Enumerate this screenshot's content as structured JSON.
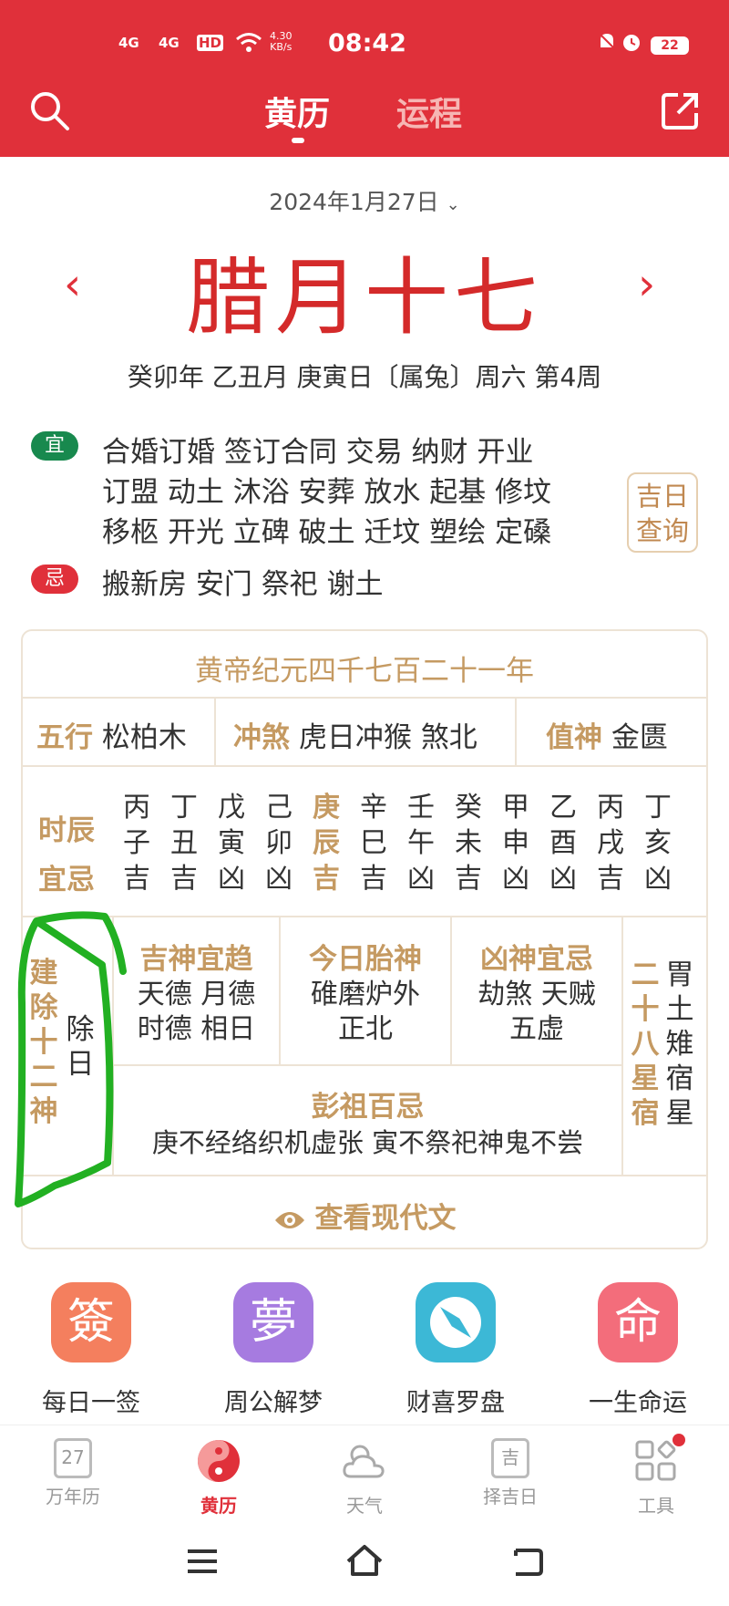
{
  "status_bar": {
    "signal1": "4G",
    "signal2": "4G",
    "hd": "HD",
    "net_speed": "4.30",
    "net_unit": "KB/s",
    "time": "08:42",
    "battery": "22"
  },
  "header": {
    "tab_active": "黄历",
    "tab_inactive": "运程",
    "search_icon": "search-icon",
    "share_icon": "share-icon"
  },
  "date": {
    "selected": "2024年1月27日",
    "lunar": "腊月十七",
    "ganzhi": "癸卯年 乙丑月 庚寅日〔属兔〕周六 第4周"
  },
  "yi": {
    "badge": "宜",
    "lines": [
      "合婚订婚  签订合同  交易  纳财  开业",
      "订盟  动土  沐浴  安葬  放水  起基  修坟",
      "移柩  开光  立碑  破土  迁坟  塑绘  定磉"
    ]
  },
  "ji": {
    "badge": "忌",
    "text": "搬新房  安门  祭祀  谢土"
  },
  "jiri": {
    "line1": "吉日",
    "line2": "查询"
  },
  "card": {
    "era": "黄帝纪元四千七百二十一年",
    "wuxing_label": "五行",
    "wuxing_value": "松柏木",
    "chongsha_label": "冲煞",
    "chongsha_value": "虎日冲猴 煞北",
    "zhishen_label": "值神",
    "zhishen_value": "金匮",
    "shichen_label1": "时辰",
    "shichen_label2": "宜忌",
    "shichen": [
      {
        "stem": "丙",
        "branch": "子",
        "luck": "吉"
      },
      {
        "stem": "丁",
        "branch": "丑",
        "luck": "吉"
      },
      {
        "stem": "戊",
        "branch": "寅",
        "luck": "凶"
      },
      {
        "stem": "己",
        "branch": "卯",
        "luck": "凶"
      },
      {
        "stem": "庚",
        "branch": "辰",
        "luck": "吉"
      },
      {
        "stem": "辛",
        "branch": "巳",
        "luck": "吉"
      },
      {
        "stem": "壬",
        "branch": "午",
        "luck": "凶"
      },
      {
        "stem": "癸",
        "branch": "未",
        "luck": "吉"
      },
      {
        "stem": "甲",
        "branch": "申",
        "luck": "凶"
      },
      {
        "stem": "乙",
        "branch": "酉",
        "luck": "凶"
      },
      {
        "stem": "丙",
        "branch": "戌",
        "luck": "吉"
      },
      {
        "stem": "丁",
        "branch": "亥",
        "luck": "凶"
      }
    ],
    "jianchu_label": "建除十二神",
    "jianchu_value": "除日",
    "jishen_label": "吉神宜趋",
    "jishen_l1": "天德 月德",
    "jishen_l2": "时德 相日",
    "taishen_label": "今日胎神",
    "taishen_l1": "碓磨炉外",
    "taishen_l2": "正北",
    "xiongshen_label": "凶神宜忌",
    "xiongshen_l1": "劫煞 天贼",
    "xiongshen_l2": "五虚",
    "xiu_label": "二十八星宿",
    "xiu_value": "胃土雉宿星",
    "pengzu_label": "彭祖百忌",
    "pengzu_value": "庚不经络织机虚张 寅不祭祀神鬼不尝",
    "view_modern": "查看现代文"
  },
  "quick": [
    {
      "glyph": "簽",
      "label": "每日一签",
      "color": "#f47f5e"
    },
    {
      "glyph": "夢",
      "label": "周公解梦",
      "color": "#a67be0"
    },
    {
      "glyph": "",
      "label": "财喜罗盘",
      "color": "#3cb8d6"
    },
    {
      "glyph": "命",
      "label": "一生命运",
      "color": "#f36d7b"
    }
  ],
  "bottom_nav": [
    {
      "label": "万年历",
      "icon": "calendar-icon",
      "num": "27"
    },
    {
      "label": "黄历",
      "icon": "huangli-icon"
    },
    {
      "label": "天气",
      "icon": "weather-icon"
    },
    {
      "label": "择吉日",
      "icon": "select-day-icon",
      "glyph": "吉"
    },
    {
      "label": "工具",
      "icon": "tools-icon"
    }
  ]
}
